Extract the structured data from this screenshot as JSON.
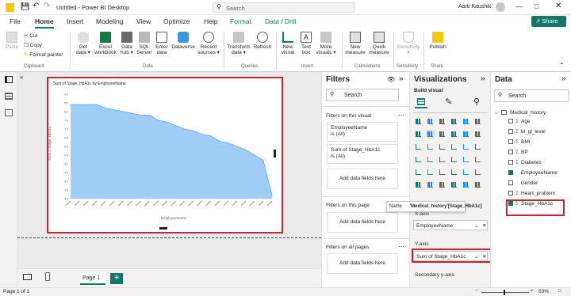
{
  "titlebar": {
    "doc_title": "Untitled - Power BI Desktop",
    "search_placeholder": "Search",
    "user": "Aarti Kaushik"
  },
  "menu": {
    "tabs": [
      "File",
      "Home",
      "Insert",
      "Modeling",
      "View",
      "Optimize",
      "Help",
      "Format",
      "Data / Drill"
    ],
    "share": "Share"
  },
  "ribbon": {
    "paste": "Paste",
    "cut": "Cut",
    "copy": "Copy",
    "format_painter": "Format painter",
    "get_data": "Get data",
    "excel": "Excel workbook",
    "data_hub": "Data hub",
    "sql": "SQL Server",
    "enter_data": "Enter data",
    "dataverse": "Dataverse",
    "recent": "Recent sources",
    "transform": "Transform data",
    "refresh": "Refresh",
    "new_visual": "New visual",
    "text_box": "Text box",
    "more_visuals": "More visuals",
    "new_measure": "New measure",
    "quick_measure": "Quick measure",
    "sensitivity": "Sensitivity",
    "publish": "Publish",
    "groups": {
      "clipboard": "Clipboard",
      "data": "Data",
      "queries": "Queries",
      "insert": "Insert",
      "calculations": "Calculations",
      "sensitivity": "Sensitivity",
      "share": "Share"
    }
  },
  "visual": {
    "title": "Sum of Stage_HbA1c by EmployeeName",
    "xlabel": "EmployeeName",
    "ylabel": "Sum of Stage_HbA1c",
    "chart_data": {
      "type": "area",
      "y_ticks": [
        "9.0",
        "8.5",
        "8.0",
        "7.5",
        "7.0",
        "6.5",
        "6.0",
        "5.5",
        "5.0",
        "4.5",
        "4.0",
        "3.5",
        "3.0"
      ],
      "ylim": [
        3.0,
        9.0
      ],
      "values": [
        8.4,
        8.4,
        8.4,
        8.4,
        8.2,
        8.1,
        8.0,
        7.9,
        7.8,
        7.8,
        7.5,
        7.4,
        7.2,
        7.0,
        6.9,
        6.7,
        6.6,
        6.3,
        6.2,
        6.0,
        5.8,
        5.5,
        5.2,
        3.2
      ],
      "fill": "#9fcdf5",
      "line": "#5ea9e5"
    }
  },
  "pages": {
    "page1": "Page 1",
    "add": "+"
  },
  "status": {
    "page": "Page 1 of 1",
    "zoom": "53%"
  },
  "filters": {
    "title": "Filters",
    "search": "Search",
    "on_visual": "Filters on this visual",
    "card1_name": "EmployeeName",
    "card1_val": "is (All)",
    "card2_name": "Sum of Stage_HbA1c",
    "card2_val": "is (All)",
    "add_fields": "Add data fields here",
    "on_page": "Filters on this page",
    "all_pages": "Filters on all pages"
  },
  "viz": {
    "title": "Visualizations",
    "build": "Build visual",
    "tooltip_name": "Name",
    "tooltip_val": "'Medical_history'[Stage_HbA1c]",
    "xaxis": "X-axis",
    "xfield": "EmployeeName",
    "yaxis": "Y-axis",
    "yfield": "Sum of Stage_HbA1c",
    "secondary": "Secondary y-axis"
  },
  "data": {
    "title": "Data",
    "search": "Search",
    "table": "Medical_history",
    "fields": [
      {
        "label": "Age",
        "sigma": true,
        "checked": false
      },
      {
        "label": "bl_gl_level",
        "sigma": true,
        "checked": false
      },
      {
        "label": "BMI",
        "sigma": true,
        "checked": false
      },
      {
        "label": "BP",
        "sigma": true,
        "checked": false
      },
      {
        "label": "Diabetes",
        "sigma": true,
        "checked": false
      },
      {
        "label": "EmployeeName",
        "sigma": false,
        "checked": true
      },
      {
        "label": "Gender",
        "sigma": false,
        "checked": false
      },
      {
        "label": "Heart_problem",
        "sigma": true,
        "checked": false
      },
      {
        "label": "Stage_HbA1c",
        "sigma": true,
        "checked": true
      }
    ]
  }
}
